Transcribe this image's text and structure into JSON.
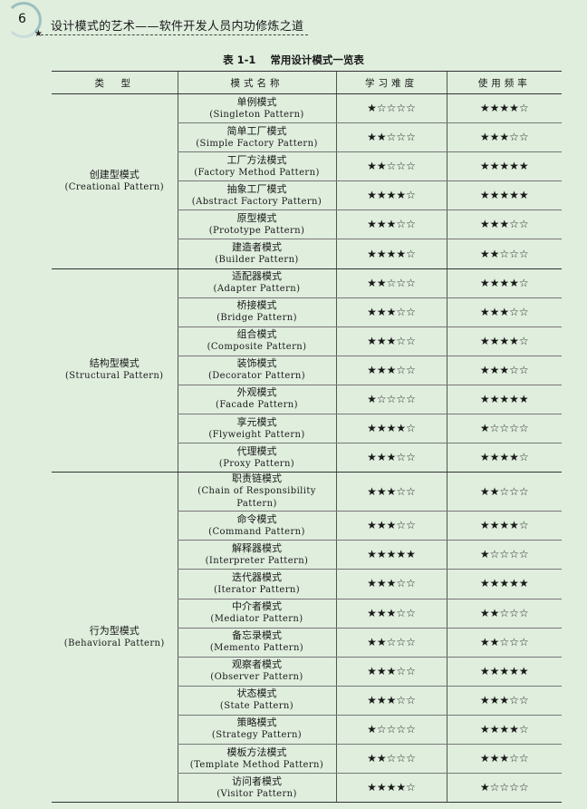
{
  "header": {
    "page_number": "6",
    "book_title": "设计模式的艺术——软件开发人员内功修炼之道"
  },
  "table": {
    "caption_number": "表 1-1",
    "caption_title": "常用设计模式一览表",
    "columns": [
      "类　型",
      "模式名称",
      "学习难度",
      "使用频率"
    ],
    "groups": [
      {
        "type_cn": "创建型模式",
        "type_en": "(Creational Pattern)",
        "patterns": [
          {
            "cn": "单例模式",
            "en": "(Singleton Pattern)",
            "difficulty": 1,
            "frequency": 4
          },
          {
            "cn": "简单工厂模式",
            "en": "(Simple Factory Pattern)",
            "difficulty": 2,
            "frequency": 3
          },
          {
            "cn": "工厂方法模式",
            "en": "(Factory Method Pattern)",
            "difficulty": 2,
            "frequency": 5
          },
          {
            "cn": "抽象工厂模式",
            "en": "(Abstract Factory Pattern)",
            "difficulty": 4,
            "frequency": 5
          },
          {
            "cn": "原型模式",
            "en": "(Prototype Pattern)",
            "difficulty": 3,
            "frequency": 3
          },
          {
            "cn": "建造者模式",
            "en": "(Builder Pattern)",
            "difficulty": 4,
            "frequency": 2
          }
        ]
      },
      {
        "type_cn": "结构型模式",
        "type_en": "(Structural Pattern)",
        "patterns": [
          {
            "cn": "适配器模式",
            "en": "(Adapter Pattern)",
            "difficulty": 2,
            "frequency": 4
          },
          {
            "cn": "桥接模式",
            "en": "(Bridge Pattern)",
            "difficulty": 3,
            "frequency": 3
          },
          {
            "cn": "组合模式",
            "en": "(Composite Pattern)",
            "difficulty": 3,
            "frequency": 4
          },
          {
            "cn": "装饰模式",
            "en": "(Decorator Pattern)",
            "difficulty": 3,
            "frequency": 3
          },
          {
            "cn": "外观模式",
            "en": "(Facade Pattern)",
            "difficulty": 1,
            "frequency": 5
          },
          {
            "cn": "享元模式",
            "en": "(Flyweight Pattern)",
            "difficulty": 4,
            "frequency": 1
          },
          {
            "cn": "代理模式",
            "en": "(Proxy Pattern)",
            "difficulty": 3,
            "frequency": 4
          }
        ]
      },
      {
        "type_cn": "行为型模式",
        "type_en": "(Behavioral Pattern)",
        "patterns": [
          {
            "cn": "职责链模式",
            "en": "(Chain of Responsibility Pattern)",
            "difficulty": 3,
            "frequency": 2
          },
          {
            "cn": "命令模式",
            "en": "(Command Pattern)",
            "difficulty": 3,
            "frequency": 4
          },
          {
            "cn": "解释器模式",
            "en": "(Interpreter Pattern)",
            "difficulty": 5,
            "frequency": 1
          },
          {
            "cn": "迭代器模式",
            "en": "(Iterator Pattern)",
            "difficulty": 3,
            "frequency": 5
          },
          {
            "cn": "中介者模式",
            "en": "(Mediator Pattern)",
            "difficulty": 3,
            "frequency": 2
          },
          {
            "cn": "备忘录模式",
            "en": "(Memento Pattern)",
            "difficulty": 2,
            "frequency": 2
          },
          {
            "cn": "观察者模式",
            "en": "(Observer Pattern)",
            "difficulty": 3,
            "frequency": 5
          },
          {
            "cn": "状态模式",
            "en": "(State Pattern)",
            "difficulty": 3,
            "frequency": 3
          },
          {
            "cn": "策略模式",
            "en": "(Strategy Pattern)",
            "difficulty": 1,
            "frequency": 4
          },
          {
            "cn": "模板方法模式",
            "en": "(Template Method Pattern)",
            "difficulty": 2,
            "frequency": 3
          },
          {
            "cn": "访问者模式",
            "en": "(Visitor Pattern)",
            "difficulty": 4,
            "frequency": 1
          }
        ]
      }
    ]
  }
}
